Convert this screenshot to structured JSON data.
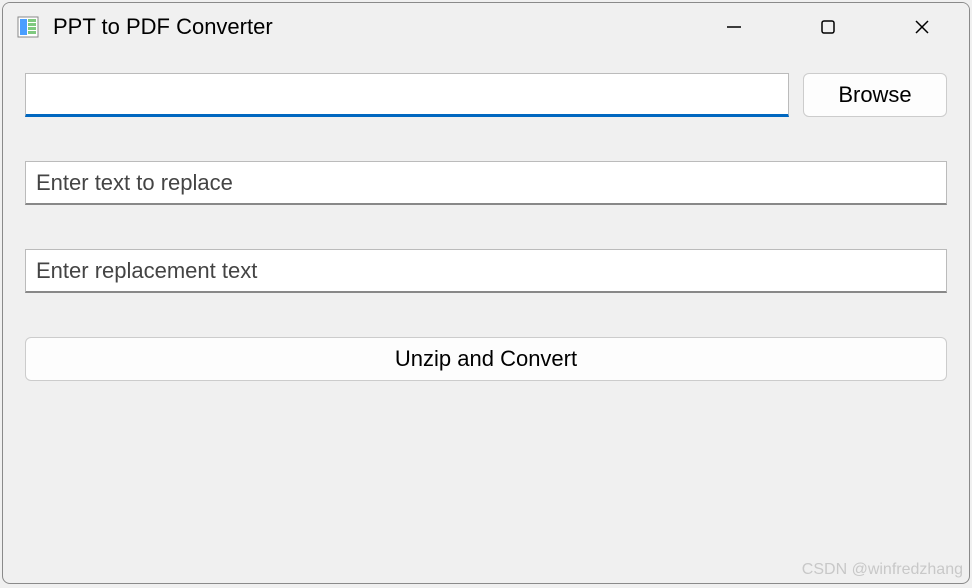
{
  "window": {
    "title": "PPT to PDF Converter"
  },
  "inputs": {
    "file_path": {
      "value": "",
      "placeholder": ""
    },
    "find_text": {
      "value": "",
      "placeholder": "Enter text to replace"
    },
    "replace_text": {
      "value": "",
      "placeholder": "Enter replacement text"
    }
  },
  "buttons": {
    "browse": "Browse",
    "convert": "Unzip and Convert"
  },
  "watermark": "CSDN @winfredzhang"
}
